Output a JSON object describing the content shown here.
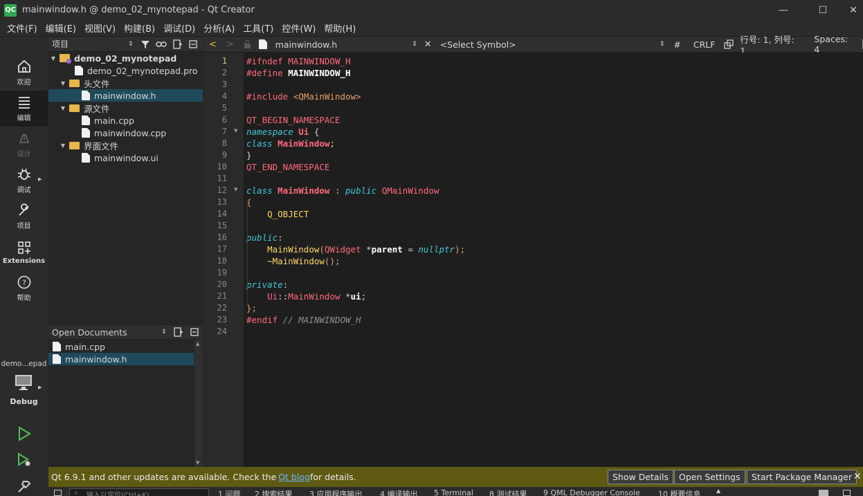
{
  "window": {
    "logo": "QC",
    "title": "mainwindow.h @ demo_02_mynotepad - Qt Creator",
    "minimize": "—",
    "maximize": "☐",
    "close": "✕"
  },
  "menu": [
    "文件(F)",
    "编辑(E)",
    "视图(V)",
    "构建(B)",
    "调试(D)",
    "分析(A)",
    "工具(T)",
    "控件(W)",
    "帮助(H)"
  ],
  "modes": [
    {
      "label": "欢迎",
      "icon": "home-icon"
    },
    {
      "label": "编辑",
      "icon": "edit-lines-icon"
    },
    {
      "label": "设计",
      "icon": "pen-icon"
    },
    {
      "label": "调试",
      "icon": "bug-icon"
    },
    {
      "label": "项目",
      "icon": "wrench-icon"
    },
    {
      "label": "Extensions",
      "icon": "extensions-icon"
    },
    {
      "label": "帮助",
      "icon": "help-icon"
    }
  ],
  "target": {
    "project": "demo...epad",
    "config": "Debug"
  },
  "project_panel": {
    "title": "项目",
    "tree": [
      {
        "label": "demo_02_mynotepad",
        "level": 0,
        "type": "project",
        "expanded": true
      },
      {
        "label": "demo_02_mynotepad.pro",
        "level": 1,
        "type": "pro"
      },
      {
        "label": "头文件",
        "level": 1,
        "type": "folder",
        "expanded": true
      },
      {
        "label": "mainwindow.h",
        "level": 2,
        "type": "h",
        "selected": true
      },
      {
        "label": "源文件",
        "level": 1,
        "type": "folder",
        "expanded": true
      },
      {
        "label": "main.cpp",
        "level": 2,
        "type": "cpp"
      },
      {
        "label": "mainwindow.cpp",
        "level": 2,
        "type": "cpp"
      },
      {
        "label": "界面文件",
        "level": 1,
        "type": "folder",
        "expanded": true
      },
      {
        "label": "mainwindow.ui",
        "level": 2,
        "type": "ui"
      }
    ]
  },
  "open_documents": {
    "title": "Open Documents",
    "items": [
      {
        "label": "main.cpp",
        "selected": false
      },
      {
        "label": "mainwindow.h",
        "selected": true
      }
    ]
  },
  "editor_toolbar": {
    "file": "mainwindow.h",
    "symbol": "<Select Symbol>",
    "hash": "#",
    "line_ending": "CRLF",
    "position": "行号: 1, 列号: 1",
    "indent": "Spaces: 4"
  },
  "editor": {
    "current_line": 1,
    "line_numbers": [
      "1",
      "2",
      "3",
      "4",
      "5",
      "6",
      "7",
      "8",
      "9",
      "10",
      "11",
      "12",
      "13",
      "14",
      "15",
      "16",
      "17",
      "18",
      "19",
      "20",
      "21",
      "22",
      "23",
      "24"
    ],
    "fold_lines": [
      7,
      12
    ]
  },
  "code": {
    "l1a": "#ifndef",
    "l1b": " MAINWINDOW_H",
    "l2a": "#define",
    "l2b": " MAINWINDOW_H",
    "l4a": "#include",
    "l4b": " <QMainWindow>",
    "l6": "QT_BEGIN_NAMESPACE",
    "l7a": "namespace",
    "l7b": "Ui",
    "l7c": " {",
    "l8a": "class",
    "l8b": "MainWindow",
    "l8c": ";",
    "l9": "}",
    "l10": "QT_END_NAMESPACE",
    "l12a": "class",
    "l12b": "MainWindow",
    "l12c": " : ",
    "l12d": "public",
    "l12e": "QMainWindow",
    "l13": "{",
    "l14": "    Q_OBJECT",
    "l16a": "public",
    "l16b": ":",
    "l17a": "    ",
    "l17b": "MainWindow",
    "l17c": "(",
    "l17d": "QWidget",
    "l17e": " *",
    "l17f": "parent",
    "l17g": " = ",
    "l17h": "nullptr",
    "l17i": ");",
    "l18a": "    ~",
    "l18b": "MainWindow",
    "l18c": "();",
    "l20a": "private",
    "l20b": ":",
    "l21a": "    ",
    "l21b": "Ui",
    "l21c": "::",
    "l21d": "MainWindow",
    "l21e": " *",
    "l21f": "ui",
    "l21g": ";",
    "l22": "};",
    "l23a": "#endif",
    "l23b": " // MAINWINDOW_H"
  },
  "notification": {
    "text_before": "Qt 6.9.1 and other updates are available. Check the ",
    "link": "Qt blog",
    "text_after": " for details.",
    "show_details": "Show Details",
    "open_settings": "Open Settings",
    "package_manager": "Start Package Manager",
    "close": "✕"
  },
  "status_bar": {
    "locator_placeholder": "输入以定位(Ctrl+K)",
    "panes": [
      "1 问题",
      "2 搜索结果",
      "3 应用程序输出",
      "4 编译输出",
      "5 Terminal",
      "8 测试结果",
      "9 QML Debugger Console",
      "10 概要信息"
    ]
  }
}
